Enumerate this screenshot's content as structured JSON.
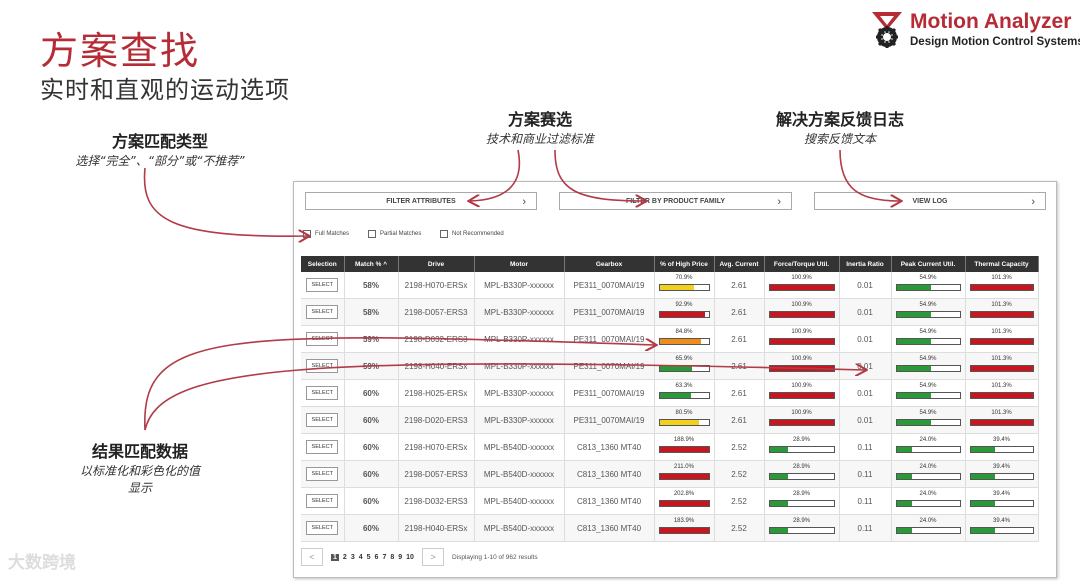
{
  "title": "方案查找",
  "subtitle": "实时和直观的运动选项",
  "logo": {
    "name": "Motion Analyzer",
    "tagline": "Design Motion Control Systems",
    "icon": "gear-logo-icon"
  },
  "annotations": {
    "match_type": {
      "title": "方案匹配类型",
      "desc": "选择“完全”、“部分”或“不推荐”"
    },
    "filter": {
      "title": "方案赛选",
      "desc": "技术和商业过滤标准"
    },
    "log": {
      "title": "解决方案反馈日志",
      "desc": "搜索反馈文本"
    },
    "result": {
      "title": "结果匹配数据",
      "desc1": "以标准化和彩色化的值",
      "desc2": "显示"
    }
  },
  "filters": {
    "attributes": "FILTER ATTRIBUTES",
    "family": "FILTER BY PRODUCT FAMILY",
    "log": "VIEW LOG"
  },
  "checkboxes": {
    "full": "Full Matches",
    "partial": "Partial Matches",
    "not_recommended": "Not Recommended"
  },
  "table": {
    "columns": [
      "Selection",
      "Match %",
      "Drive",
      "Motor",
      "Gearbox",
      "% of High Price",
      "Avg. Current",
      "Force/Torque Util.",
      "Inertia Ratio",
      "Peak Current Util.",
      "Thermal Capacity"
    ],
    "sort_indicator": "^",
    "select_label": "SELECT",
    "rows": [
      {
        "match": "58%",
        "drive": "2198-H070-ERSx",
        "motor": "MPL-B330P-xxxxxx",
        "gearbox": "PE311_0070MAI/19",
        "price": {
          "t": "70.9%",
          "p": 0.709,
          "c": "#f2d01e"
        },
        "avg": "2.61",
        "force": {
          "t": "100.9%",
          "p": 1.0,
          "c": "#c8151e"
        },
        "inertia": "0.01",
        "peak": {
          "t": "54.9%",
          "p": 0.549,
          "c": "#2a9a38"
        },
        "thermal": {
          "t": "101.3%",
          "p": 1.0,
          "c": "#c8151e"
        }
      },
      {
        "match": "58%",
        "drive": "2198-D057-ERS3",
        "motor": "MPL-B330P-xxxxxx",
        "gearbox": "PE311_0070MAI/19",
        "price": {
          "t": "92.9%",
          "p": 0.929,
          "c": "#c8151e"
        },
        "avg": "2.61",
        "force": {
          "t": "100.9%",
          "p": 1.0,
          "c": "#c8151e"
        },
        "inertia": "0.01",
        "peak": {
          "t": "54.9%",
          "p": 0.549,
          "c": "#2a9a38"
        },
        "thermal": {
          "t": "101.3%",
          "p": 1.0,
          "c": "#c8151e"
        }
      },
      {
        "match": "59%",
        "drive": "2198-D032-ERS3",
        "motor": "MPL-B330P-xxxxxx",
        "gearbox": "PE311_0070MAI/19",
        "price": {
          "t": "84.8%",
          "p": 0.848,
          "c": "#f08c1c"
        },
        "avg": "2.61",
        "force": {
          "t": "100.9%",
          "p": 1.0,
          "c": "#c8151e"
        },
        "inertia": "0.01",
        "peak": {
          "t": "54.9%",
          "p": 0.549,
          "c": "#2a9a38"
        },
        "thermal": {
          "t": "101.3%",
          "p": 1.0,
          "c": "#c8151e"
        }
      },
      {
        "match": "59%",
        "drive": "2198-H040-ERSx",
        "motor": "MPL-B330P-xxxxxx",
        "gearbox": "PE311_0070MAI/19",
        "price": {
          "t": "65.9%",
          "p": 0.659,
          "c": "#2a9a38"
        },
        "avg": "2.61",
        "force": {
          "t": "100.9%",
          "p": 1.0,
          "c": "#c8151e"
        },
        "inertia": "0.01",
        "peak": {
          "t": "54.9%",
          "p": 0.549,
          "c": "#2a9a38"
        },
        "thermal": {
          "t": "101.3%",
          "p": 1.0,
          "c": "#c8151e"
        }
      },
      {
        "match": "60%",
        "drive": "2198-H025-ERSx",
        "motor": "MPL-B330P-xxxxxx",
        "gearbox": "PE311_0070MAI/19",
        "price": {
          "t": "63.3%",
          "p": 0.633,
          "c": "#2a9a38"
        },
        "avg": "2.61",
        "force": {
          "t": "100.9%",
          "p": 1.0,
          "c": "#c8151e"
        },
        "inertia": "0.01",
        "peak": {
          "t": "54.9%",
          "p": 0.549,
          "c": "#2a9a38"
        },
        "thermal": {
          "t": "101.3%",
          "p": 1.0,
          "c": "#c8151e"
        }
      },
      {
        "match": "60%",
        "drive": "2198-D020-ERS3",
        "motor": "MPL-B330P-xxxxxx",
        "gearbox": "PE311_0070MAI/19",
        "price": {
          "t": "80.5%",
          "p": 0.805,
          "c": "#f2d01e"
        },
        "avg": "2.61",
        "force": {
          "t": "100.9%",
          "p": 1.0,
          "c": "#c8151e"
        },
        "inertia": "0.01",
        "peak": {
          "t": "54.9%",
          "p": 0.549,
          "c": "#2a9a38"
        },
        "thermal": {
          "t": "101.3%",
          "p": 1.0,
          "c": "#c8151e"
        }
      },
      {
        "match": "60%",
        "drive": "2198-H070-ERSx",
        "motor": "MPL-B540D-xxxxxx",
        "gearbox": "C813_1360 MT40",
        "price": {
          "t": "188.9%",
          "p": 1.0,
          "c": "#c8151e"
        },
        "avg": "2.52",
        "force": {
          "t": "28.9%",
          "p": 0.289,
          "c": "#2a9a38"
        },
        "inertia": "0.11",
        "peak": {
          "t": "24.0%",
          "p": 0.24,
          "c": "#2a9a38"
        },
        "thermal": {
          "t": "39.4%",
          "p": 0.394,
          "c": "#2a9a38"
        }
      },
      {
        "match": "60%",
        "drive": "2198-D057-ERS3",
        "motor": "MPL-B540D-xxxxxx",
        "gearbox": "C813_1360 MT40",
        "price": {
          "t": "211.0%",
          "p": 1.0,
          "c": "#c8151e"
        },
        "avg": "2.52",
        "force": {
          "t": "28.9%",
          "p": 0.289,
          "c": "#2a9a38"
        },
        "inertia": "0.11",
        "peak": {
          "t": "24.0%",
          "p": 0.24,
          "c": "#2a9a38"
        },
        "thermal": {
          "t": "39.4%",
          "p": 0.394,
          "c": "#2a9a38"
        }
      },
      {
        "match": "60%",
        "drive": "2198-D032-ERS3",
        "motor": "MPL-B540D-xxxxxx",
        "gearbox": "C813_1360 MT40",
        "price": {
          "t": "202.8%",
          "p": 1.0,
          "c": "#c8151e"
        },
        "avg": "2.52",
        "force": {
          "t": "28.9%",
          "p": 0.289,
          "c": "#2a9a38"
        },
        "inertia": "0.11",
        "peak": {
          "t": "24.0%",
          "p": 0.24,
          "c": "#2a9a38"
        },
        "thermal": {
          "t": "39.4%",
          "p": 0.394,
          "c": "#2a9a38"
        }
      },
      {
        "match": "60%",
        "drive": "2198-H040-ERSx",
        "motor": "MPL-B540D-xxxxxx",
        "gearbox": "C813_1360 MT40",
        "price": {
          "t": "183.9%",
          "p": 1.0,
          "c": "#c8151e"
        },
        "avg": "2.52",
        "force": {
          "t": "28.9%",
          "p": 0.289,
          "c": "#2a9a38"
        },
        "inertia": "0.11",
        "peak": {
          "t": "24.0%",
          "p": 0.24,
          "c": "#2a9a38"
        },
        "thermal": {
          "t": "39.4%",
          "p": 0.394,
          "c": "#2a9a38"
        }
      }
    ]
  },
  "pager": {
    "prev": "<",
    "next": ">",
    "pages": [
      "1",
      "2",
      "3",
      "4",
      "5",
      "6",
      "7",
      "8",
      "9",
      "10"
    ],
    "current": "1",
    "summary": "Displaying 1-10 of 962 results"
  },
  "watermark": "大数跨境",
  "colors": {
    "accent": "#b52b36",
    "arrow": "#b23b48"
  }
}
